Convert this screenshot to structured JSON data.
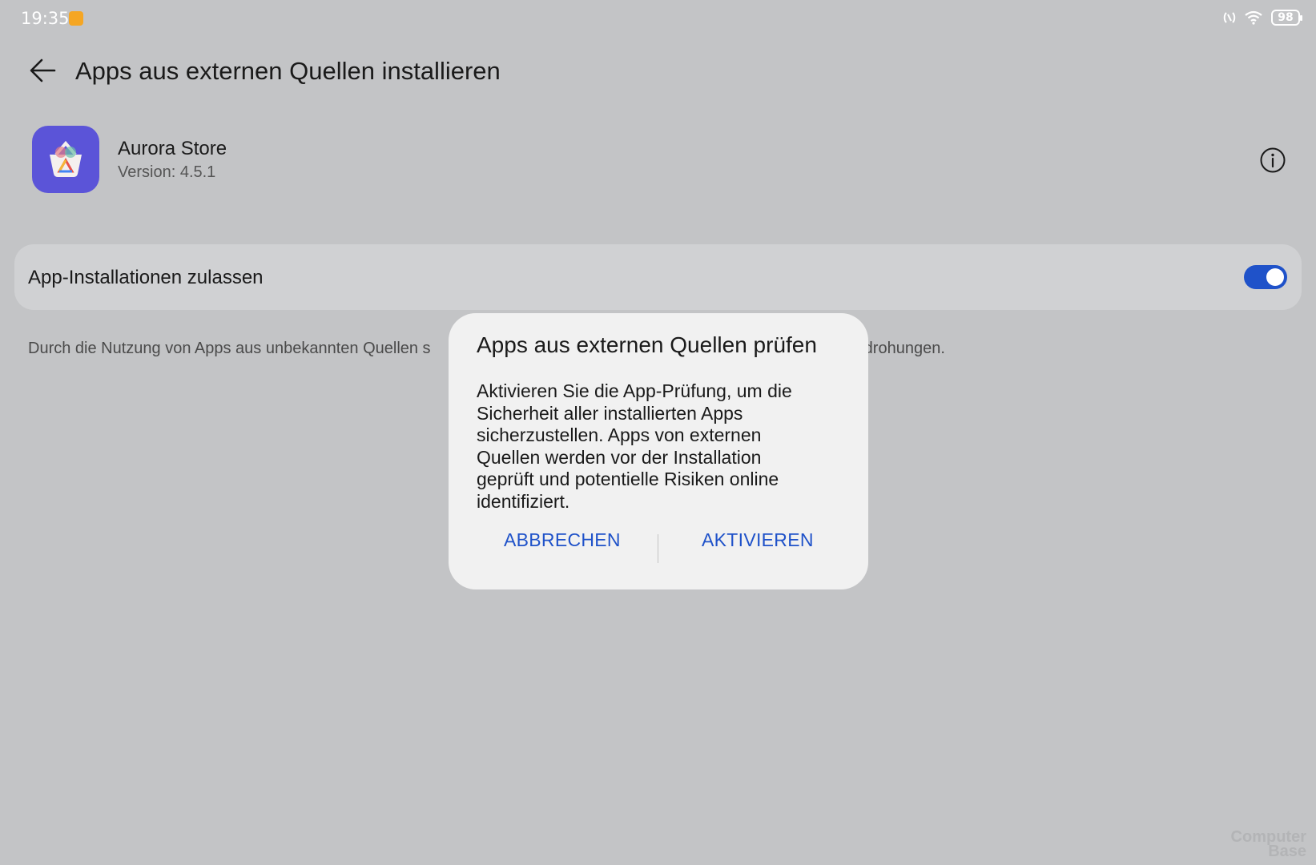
{
  "status_bar": {
    "time": "19:35",
    "battery": "98",
    "icons": [
      "notification-app-icon",
      "nfc-icon",
      "wifi-icon",
      "battery-icon"
    ]
  },
  "header": {
    "title": "Apps aus externen Quellen installieren",
    "back_icon": "arrow-left-icon"
  },
  "app": {
    "name": "Aurora Store",
    "version": "Version: 4.5.1",
    "icon": "aurora-store-icon",
    "icon_color": "#5b54d8"
  },
  "setting": {
    "label": "App-Installationen zulassen",
    "enabled": true,
    "accent": "#1f52c9"
  },
  "description_visible_left": "Durch die Nutzung von Apps aus unbekannten Quellen s",
  "description_visible_right": "edrohungen.",
  "dialog": {
    "title": "Apps aus externen Quellen prüfen",
    "body": "Aktivieren Sie die App-Prüfung, um die Sicherheit aller installierten Apps sicherzustellen. Apps von externen Quellen werden vor der Installation geprüft und potentielle Risiken online identifiziert.",
    "cancel_label": "ABBRECHEN",
    "confirm_label": "AKTIVIEREN"
  },
  "watermark": {
    "line1": "Computer",
    "line2": "Base"
  }
}
